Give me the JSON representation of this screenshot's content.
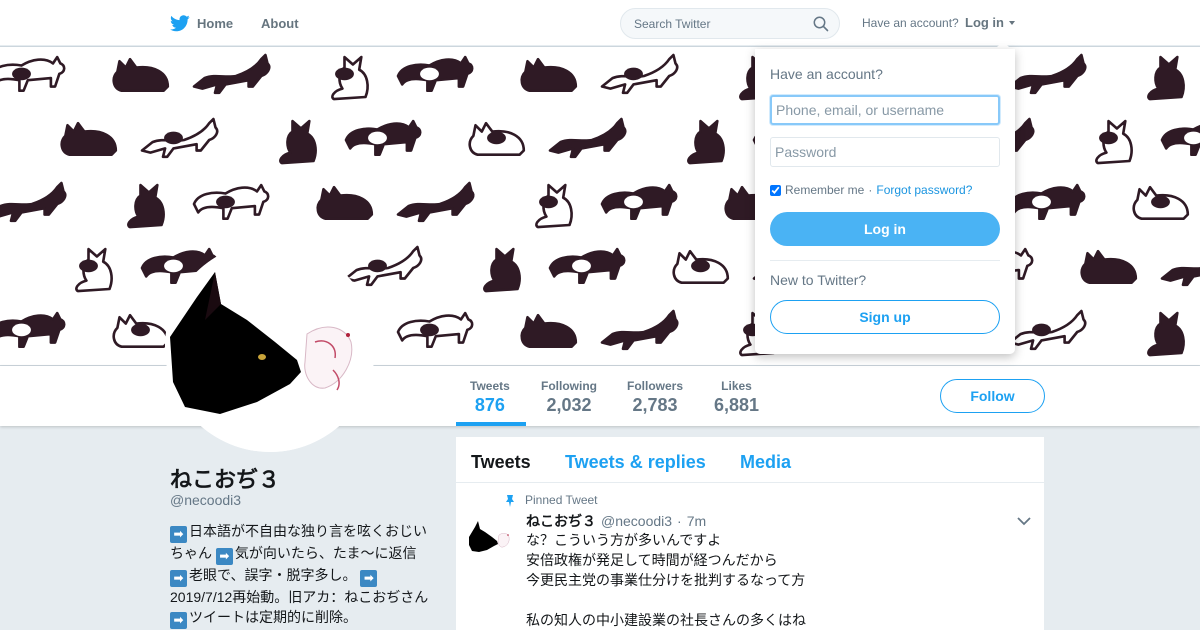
{
  "nav": {
    "home_label": "Home",
    "about_label": "About",
    "search_placeholder": "Search Twitter",
    "have_account": "Have an account?",
    "login_label": "Log in"
  },
  "profile_stats": [
    {
      "label": "Tweets",
      "value": "876",
      "active": true
    },
    {
      "label": "Following",
      "value": "2,032",
      "active": false
    },
    {
      "label": "Followers",
      "value": "2,783",
      "active": false
    },
    {
      "label": "Likes",
      "value": "6,881",
      "active": false
    }
  ],
  "follow_label": "Follow",
  "profile": {
    "name": "ねこおぢ３",
    "handle": "@necoodi3",
    "bio": [
      {
        "type": "arrow",
        "text": "➡"
      },
      {
        "type": "text",
        "text": "日本語が不自由な独り言を呟くおじいちゃん "
      },
      {
        "type": "arrow",
        "text": "➡"
      },
      {
        "type": "text",
        "text": "気が向いたら、たま～に返信 "
      },
      {
        "type": "arrow",
        "text": "➡"
      },
      {
        "type": "text",
        "text": "老眼で、誤字・脱字多し。 "
      },
      {
        "type": "arrow",
        "text": "➡"
      },
      {
        "type": "text",
        "text": "2019/7/12再始動。旧アカ：ねこおぢさん "
      },
      {
        "type": "arrow",
        "text": "➡"
      },
      {
        "type": "text",
        "text": "ツイートは定期的に削除。"
      }
    ]
  },
  "timeline": {
    "tabs": [
      "Tweets",
      "Tweets & replies",
      "Media"
    ],
    "pinned_label": "Pinned Tweet",
    "tweet": {
      "name": "ねこおぢ３",
      "handle": "@necoodi3",
      "separator": "·",
      "time": "7m",
      "body": "な？こういう方が多いんですよ\n安倍政権が発足して時間が経つんだから\n今更民主党の事業仕分けを批判するなって方\n\n私の知人の中小建設業の社長さんの多くはね"
    }
  },
  "login_dropdown": {
    "title": "Have an account?",
    "username_placeholder": "Phone, email, or username",
    "password_placeholder": "Password",
    "remember_label": "Remember me",
    "separator": "·",
    "forgot_label": "Forgot password?",
    "login_button": "Log in",
    "new_label": "New to Twitter?",
    "signup_button": "Sign up"
  },
  "colors": {
    "brand": "#1da1f2",
    "banner_cat": "#2f1a25"
  }
}
